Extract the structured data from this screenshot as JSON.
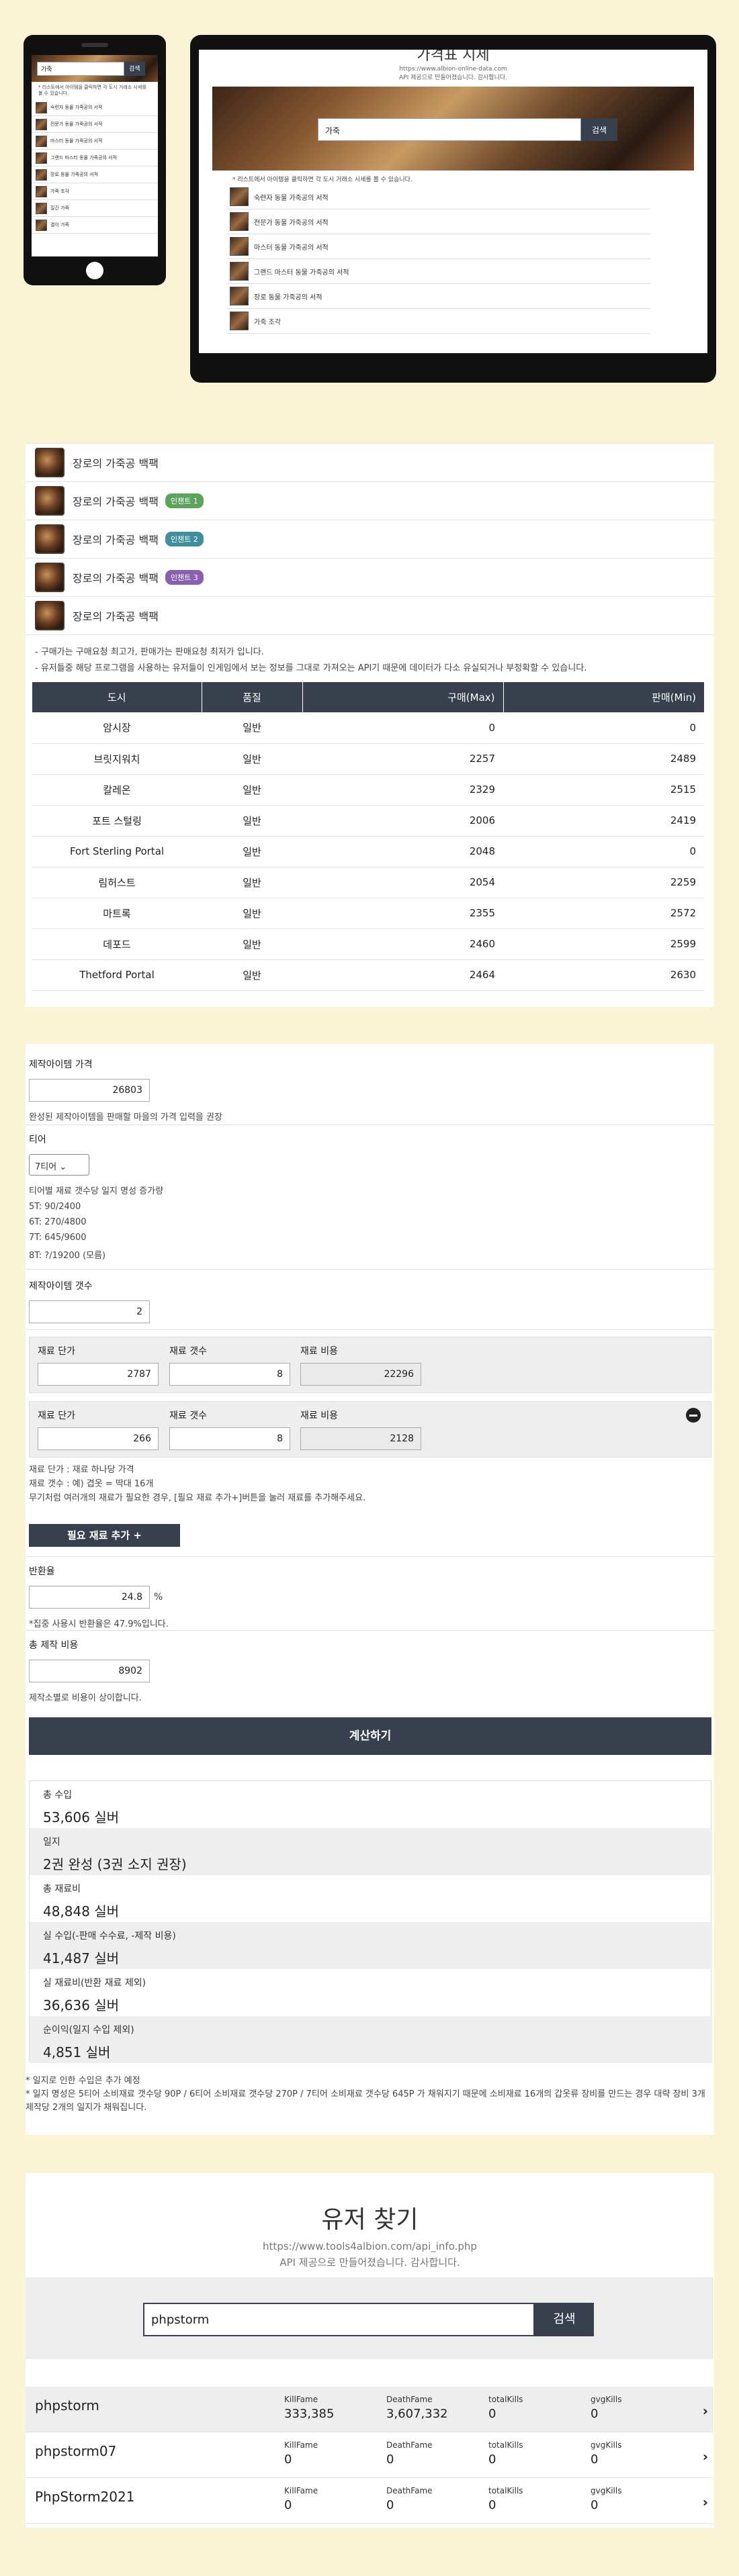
{
  "hero": {
    "tablet_title": "가격표 지세",
    "tablet_url": "https://www.albion-online-data.com",
    "tablet_credit": "API 제공으로 만들어졌습니다. 감사합니다.",
    "search_value": "가죽",
    "search_button": "검색",
    "note": "* 리스트에서 아이템을 클릭하면 각 도시 거래소 시세를 볼 수 있습니다.",
    "items": [
      "숙련자 동물 가죽공의 서적",
      "전문가 동물 가죽공의 서적",
      "마스터 동물 가죽공의 서적",
      "그랜드 마스터 동물 가죽공의 서적",
      "장로 동물 가죽공의 서적",
      "가죽 조각"
    ],
    "phone_items": [
      "숙련자 동물 가죽공의 서적",
      "전문가 동물 가죽공의 서적",
      "마스터 동물 가죽공의 서적",
      "그랜드 마스터 동물 가죽공의 서적",
      "장로 동물 가죽공의 서적",
      "가죽 조각",
      "질긴 가죽",
      "결이 가죽"
    ]
  },
  "price_section": {
    "items": [
      {
        "label": "장로의 가죽공 백팩",
        "badge": ""
      },
      {
        "label": "장로의 가죽공 백팩",
        "badge": "인챈트 1"
      },
      {
        "label": "장로의 가죽공 백팩",
        "badge": "인챈트 2"
      },
      {
        "label": "장로의 가죽공 백팩",
        "badge": "인챈트 3"
      },
      {
        "label": "장로의 가죽공 백팩",
        "badge": ""
      }
    ],
    "badge_colors": {
      "인챈트 1": "#5ca45c",
      "인챈트 2": "#3f8f9c",
      "인챈트 3": "#8a5fb0"
    },
    "notes": [
      "- 구매가는 구매요청 최고가, 판매가는 판매요청 최저가 입니다.",
      "- 유저들중 해당 프로그램을 사용하는 유저들이 인게임에서 보는 정보를 그대로 가져오는 API기 때문에 데이터가 다소 유실되거나 부정확할 수 있습니다."
    ],
    "columns": [
      "도시",
      "품질",
      "구매(Max)",
      "판매(Min)"
    ],
    "rows": [
      [
        "암시장",
        "일반",
        "0",
        "0"
      ],
      [
        "브릿지워치",
        "일반",
        "2257",
        "2489"
      ],
      [
        "칼레온",
        "일반",
        "2329",
        "2515"
      ],
      [
        "포트 스털링",
        "일반",
        "2006",
        "2419"
      ],
      [
        "Fort Sterling Portal",
        "일반",
        "2048",
        "0"
      ],
      [
        "림허스트",
        "일반",
        "2054",
        "2259"
      ],
      [
        "마트록",
        "일반",
        "2355",
        "2572"
      ],
      [
        "데포드",
        "일반",
        "2460",
        "2599"
      ],
      [
        "Thetford Portal",
        "일반",
        "2464",
        "2630"
      ]
    ]
  },
  "calc": {
    "craft_price_label": "제작아이템 가격",
    "craft_price_value": "26803",
    "craft_price_hint": "완성된 제작아이템을 판매할 마을의 가격 입력을 권장",
    "tier_label": "티어",
    "tier_value": "7티어 ⌄",
    "tier_info_title": "티어별 재료 갯수당 일지 명성 증가량",
    "tier_info": [
      "5T: 90/2400",
      "6T: 270/4800",
      "7T: 645/9600",
      "8T: ?/19200 (모름)"
    ],
    "craft_count_label": "제작아이템 갯수",
    "craft_count_value": "2",
    "mat_labels": {
      "unit": "재료 단가",
      "count": "재료 갯수",
      "cost": "재료 비용"
    },
    "materials": [
      {
        "unit": "2787",
        "count": "8",
        "cost": "22296"
      },
      {
        "unit": "266",
        "count": "8",
        "cost": "2128"
      }
    ],
    "mat_notes": [
      "재료 단가 : 재료 하나당 가격",
      "재료 갯수 : 예) 겹옷 = 딱대 16개",
      "무기처럼 여러개의 재료가 필요한 경우, [필요 재료 추가+]버튼을 눌러 재료를 추가해주세요."
    ],
    "add_material_button": "필요 재료 추가 +",
    "return_label": "반환율",
    "return_value": "24.8",
    "return_unit": "%",
    "return_hint": "*집중 사용시 반환율은 47.9%입니다.",
    "fee_label": "총 제작 비용",
    "fee_value": "8902",
    "fee_hint": "제작소별로 비용이 상이합니다.",
    "calc_button": "계산하기",
    "results": [
      {
        "k": "총 수입",
        "v": "53,606 실버"
      },
      {
        "k": "일지",
        "v": "2권 완성 (3권 소지 권장)"
      },
      {
        "k": "총 재료비",
        "v": "48,848 실버"
      },
      {
        "k": "실 수입(-판매 수수료, -제작 비용)",
        "v": "41,487 실버"
      },
      {
        "k": "실 재료비(반환 재료 제외)",
        "v": "36,636 실버"
      },
      {
        "k": "순이익(일지 수입 제외)",
        "v": "4,851 실버"
      }
    ],
    "foot_notes": [
      "* 일지로 인한 수입은 추가 예정",
      "* 일지 명성은 5티어 소비재료 갯수당 90P / 6티어 소비재료 갯수당 270P / 7티어 소비재료 갯수당 645P 가 채워지기 때문에 소비재료 16개의 갑옷류 장비를 만드는 경우 대략 장비 3개 제작당 2개의 일지가 채워집니다."
    ]
  },
  "user": {
    "title": "유저 찾기",
    "url": "https://www.tools4albion.com/api_info.php",
    "credit": "API 제공으로 만들어졌습니다. 감사합니다.",
    "search_value": "phpstorm",
    "search_button": "검색",
    "stat_labels": [
      "KillFame",
      "DeathFame",
      "totalKills",
      "gvgKills"
    ],
    "results": [
      {
        "name": "phpstorm",
        "stats": [
          "333,385",
          "3,607,332",
          "0",
          "0"
        ]
      },
      {
        "name": "phpstorm07",
        "stats": [
          "0",
          "0",
          "0",
          "0"
        ]
      },
      {
        "name": "PhpStorm2021",
        "stats": [
          "0",
          "0",
          "0",
          "0"
        ]
      }
    ]
  }
}
